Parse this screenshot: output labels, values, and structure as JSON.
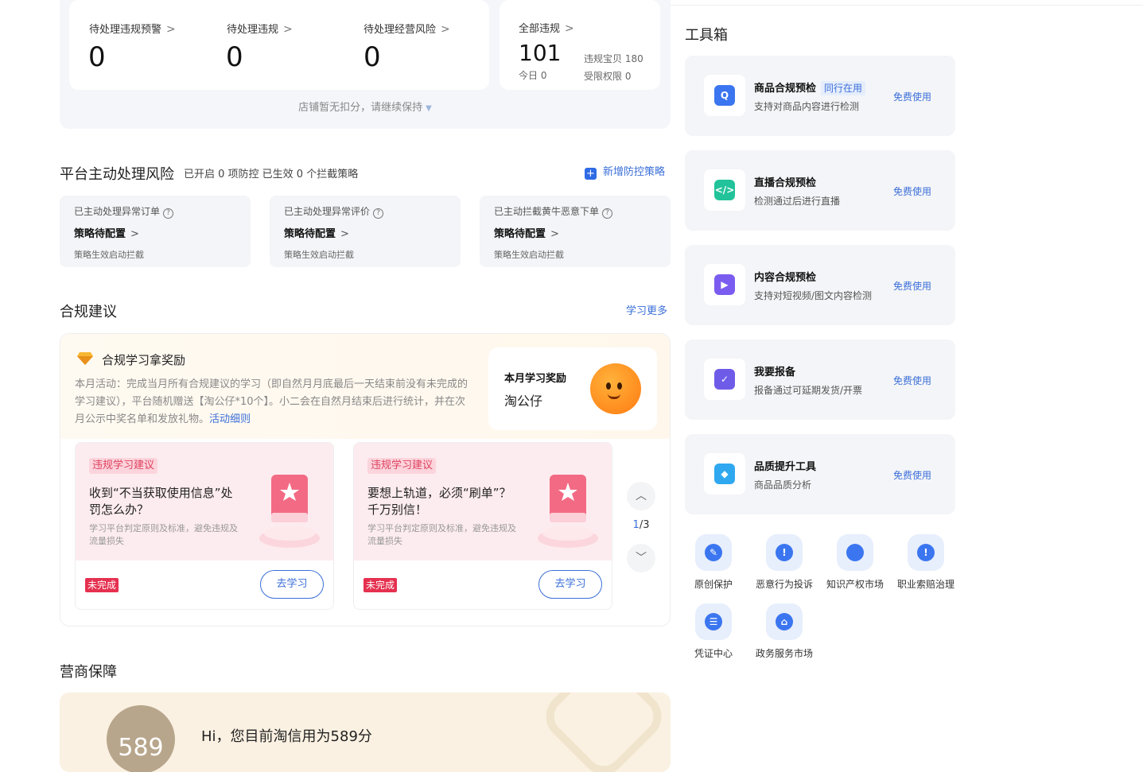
{
  "stats": {
    "items": [
      {
        "label": "待处理违规预警",
        "value": "0"
      },
      {
        "label": "待处理违规",
        "value": "0"
      },
      {
        "label": "待处理经营风险",
        "value": "0"
      }
    ],
    "all": {
      "label": "全部违规",
      "value": "101",
      "today": "今日 0",
      "baby": "违规宝贝 180",
      "limit": "受限权限 0"
    },
    "note": "店铺暂无扣分，请继续保持"
  },
  "platform_risk": {
    "title": "平台主动处理风险",
    "summary": "已开启 0 项防控 已生效 0 个拦截策略",
    "add_label": "新增防控策略",
    "cards": [
      {
        "label": "已主动处理异常订单",
        "status": "策略待配置",
        "note": "策略生效启动拦截"
      },
      {
        "label": "已主动处理异常评价",
        "status": "策略待配置",
        "note": "策略生效启动拦截"
      },
      {
        "label": "已主动拦截黄牛恶意下单",
        "status": "策略待配置",
        "note": "策略生效启动拦截"
      }
    ]
  },
  "compliance": {
    "title": "合规建议",
    "more": "学习更多",
    "reward_title": "合规学习拿奖励",
    "reward_desc": "本月活动：完成当月所有合规建议的学习（即自然月月底最后一天结束前没有未完成的学习建议），平台随机赠送【淘公仔*10个】。小二会在自然月结束后进行统计，并在次月公示中奖名单和发放礼物。",
    "reward_link": "活动细则",
    "reward_card_title": "本月学习奖励",
    "reward_card_value": "淘公仔",
    "cards": [
      {
        "tag": "违规学习建议",
        "title": "收到“不当获取使用信息”处罚怎么办？",
        "desc": "学习平台判定原则及标准，避免违规及流量损失",
        "status": "未完成",
        "button": "去学习"
      },
      {
        "tag": "违规学习建议",
        "title": "要想上轨道，必须“刷单”？千万别信！",
        "desc": "学习平台判定原则及标准，避免违规及流量损失",
        "status": "未完成",
        "button": "去学习"
      }
    ],
    "pager_current": "1",
    "pager_total": "/3"
  },
  "merchant": {
    "title": "营商保障",
    "score": "589",
    "greeting": "Hi，您目前淘信用为589分"
  },
  "toolbox": {
    "title": "工具箱",
    "tools": [
      {
        "name": "商品合规预检",
        "tag": "同行在用",
        "desc": "支持对商品内容进行检测",
        "use": "免费使用",
        "icon": "shield-search-icon",
        "color": "#3b76f0"
      },
      {
        "name": "直播合规预检",
        "tag": "",
        "desc": "检测通过后进行直播",
        "use": "免费使用",
        "icon": "code-icon",
        "color": "#22c39a"
      },
      {
        "name": "内容合规预检",
        "tag": "",
        "desc": "支持对短视频/图文内容检测",
        "use": "免费使用",
        "icon": "video-icon",
        "color": "#7b5cf0"
      },
      {
        "name": "我要报备",
        "tag": "",
        "desc": "报备通过可延期发货/开票",
        "use": "免费使用",
        "icon": "envelope-check-icon",
        "color": "#6e5be8"
      },
      {
        "name": "品质提升工具",
        "tag": "",
        "desc": "商品品质分析",
        "use": "免费使用",
        "icon": "diamond-icon",
        "color": "#2fa8f0"
      }
    ],
    "quick": [
      {
        "label": "原创保护",
        "icon": "pen-icon",
        "glyph": "✎"
      },
      {
        "label": "恶意行为投诉",
        "icon": "alert-icon",
        "glyph": "!"
      },
      {
        "label": "知识产权市场",
        "icon": "bulb-icon",
        "glyph": ""
      },
      {
        "label": "职业索赔治理",
        "icon": "alert-icon",
        "glyph": "!"
      },
      {
        "label": "凭证中心",
        "icon": "ticket-icon",
        "glyph": "☰"
      },
      {
        "label": "政务服务市场",
        "icon": "government-icon",
        "glyph": "⌂"
      }
    ]
  }
}
